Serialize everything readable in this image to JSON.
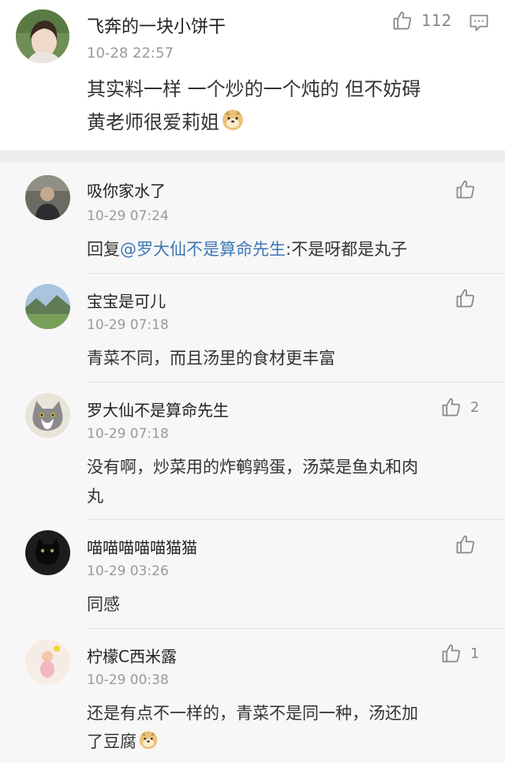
{
  "top_comment": {
    "username": "飞奔的一块小饼干",
    "time": "10-28 22:57",
    "likes": "112",
    "line1": "其实料一样 一个炒的一个炖的 但不妨碍",
    "line2": "黄老师很爱莉姐",
    "like_icon": "thumbs-up-icon",
    "reply_icon": "comment-icon",
    "emoji": "doge-emoji"
  },
  "replies": [
    {
      "username": "吸你家水了",
      "time": "10-29 07:24",
      "prefix": "回复",
      "mention": "@罗大仙不是算命先生",
      "suffix": ":不是呀都是丸子",
      "likes": ""
    },
    {
      "username": "宝宝是可儿",
      "time": "10-29 07:18",
      "text": "青菜不同，而且汤里的食材更丰富",
      "likes": ""
    },
    {
      "username": "罗大仙不是算命先生",
      "time": "10-29 07:18",
      "line1": "没有啊，炒菜用的炸鹌鹑蛋，汤菜是鱼丸和肉",
      "line2": "丸",
      "likes": "2"
    },
    {
      "username": "喵喵喵喵喵猫猫",
      "time": "10-29 03:26",
      "text": "同感",
      "likes": ""
    },
    {
      "username": "柠檬C西米露",
      "time": "10-29 00:38",
      "line1": "还是有点不一样的，青菜不是同一种，汤还加",
      "line2": "了豆腐",
      "likes": "1"
    }
  ],
  "colors": {
    "mention": "#3e78b5",
    "time": "#9a9a9a",
    "reply_bg": "#f7f7f7"
  }
}
